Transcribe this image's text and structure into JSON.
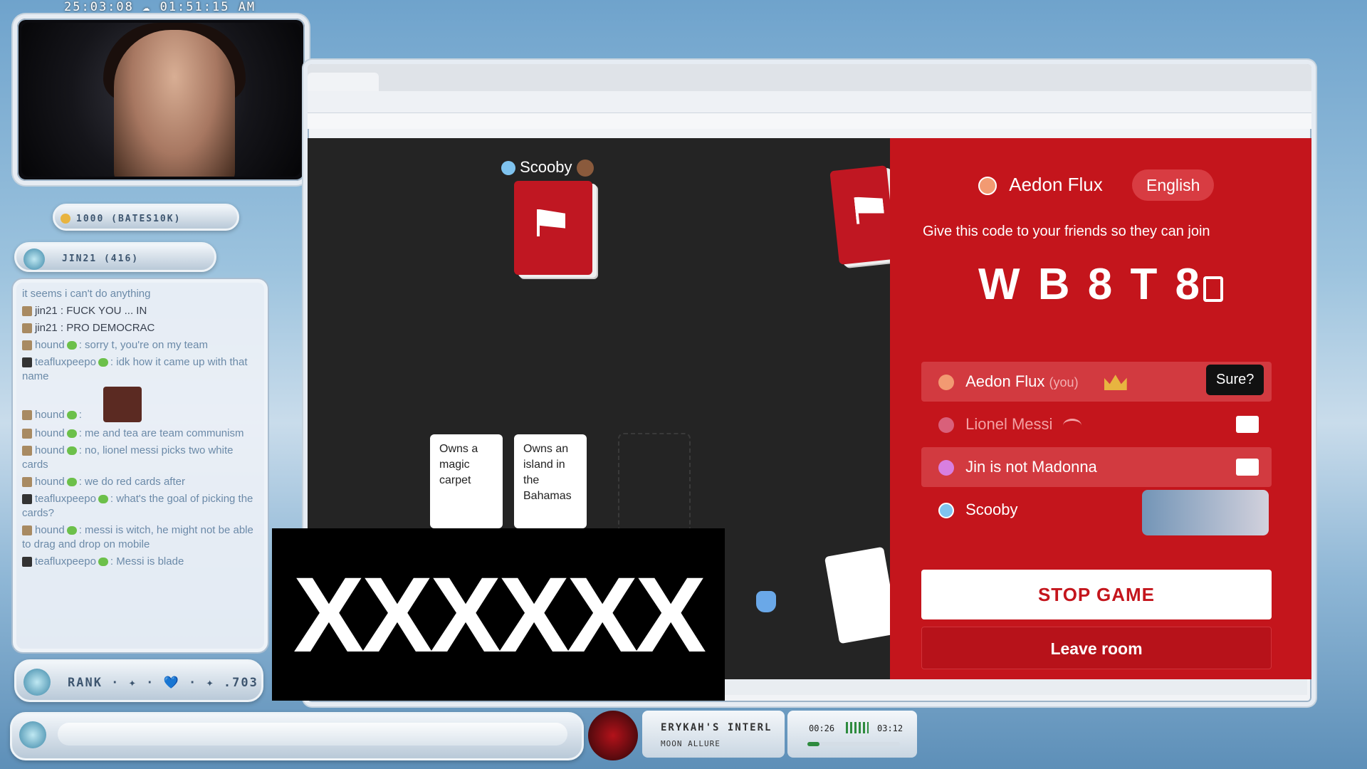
{
  "overlay": {
    "timestamp": "25:03:08 ☁ 01:51:15 AM",
    "points_label": "1000 (BATES10K)",
    "top_chatter_label": "JIN21 (416)",
    "rank_label": "RANK · ✦ · 💙 · ✦ .703",
    "censor_text": "XXXXXX",
    "now_playing": {
      "title": "ERYKAH'S INTERL",
      "artist": "MOON ALLURE"
    },
    "timer": {
      "elapsed": "00:26",
      "total": "03:12",
      "progress": 0.13
    }
  },
  "chat": {
    "messages": [
      {
        "user": "",
        "text": "it seems i can't do anything"
      },
      {
        "user": "jin21",
        "text": ": FUCK YOU ... IN"
      },
      {
        "user": "jin21",
        "text": ": PRO DEMOCRAC"
      },
      {
        "user": "hound",
        "text": ": sorry t, you're on my team"
      },
      {
        "user": "teafluxpeepo",
        "text": ": idk how it came up with that name"
      },
      {
        "user": "hound",
        "text": ":"
      },
      {
        "user": "hound",
        "text": ": me and tea are team communism"
      },
      {
        "user": "hound",
        "text": ": no, lionel messi picks two white cards"
      },
      {
        "user": "hound",
        "text": ": we do red cards after"
      },
      {
        "user": "teafluxpeepo",
        "text": ": what's the goal of picking the cards?"
      },
      {
        "user": "hound",
        "text": ": messi is witch, he might not be able to drag and drop on mobile"
      },
      {
        "user": "teafluxpeepo",
        "text": ": Messi is blade"
      }
    ]
  },
  "game": {
    "current_player": "Scooby",
    "white_cards": [
      "Owns a magic carpet",
      "Owns an island in the Bahamas"
    ]
  },
  "sidebar": {
    "host_name": "Aedon Flux",
    "language": "English",
    "instructions": "Give this code to your friends so they can join",
    "room_code": "W B 8 T 8",
    "players": [
      {
        "name": "Aedon Flux",
        "suffix": "(you)",
        "color": "#f29a72",
        "role": "host"
      },
      {
        "name": "Lionel Messi",
        "suffix": "",
        "color": "#d9607a",
        "role": "disconnected"
      },
      {
        "name": "Jin is not Madonna",
        "suffix": "",
        "color": "#d87fe0",
        "role": "player"
      },
      {
        "name": "Scooby",
        "suffix": "",
        "color": "#7fc3ef",
        "role": "player"
      }
    ],
    "tooltip": "Sure?",
    "stop_label": "STOP GAME",
    "leave_label": "Leave room"
  },
  "colors": {
    "accent_red": "#c4151c",
    "board": "#242424"
  }
}
